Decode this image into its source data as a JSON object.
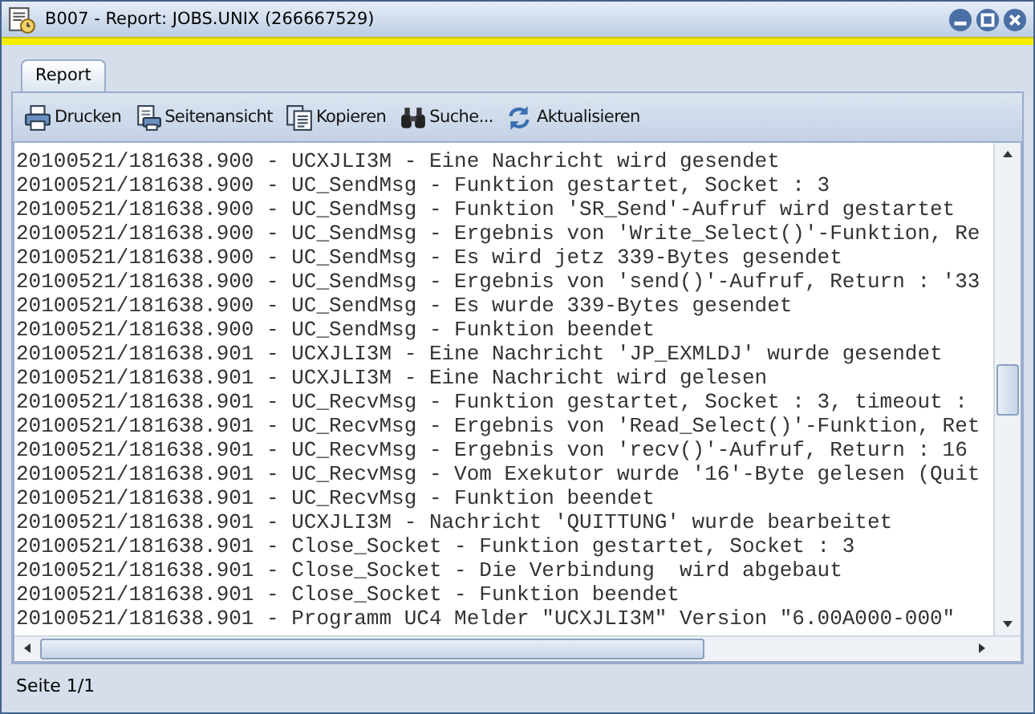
{
  "window": {
    "title": "B007 - Report: JOBS.UNIX (266667529)"
  },
  "tabs": [
    {
      "label": "Report",
      "selected": true
    }
  ],
  "toolbar": [
    {
      "kind": "print",
      "label": "Drucken"
    },
    {
      "kind": "preview",
      "label": "Seitenansicht"
    },
    {
      "kind": "copy",
      "label": "Kopieren"
    },
    {
      "kind": "search",
      "label": "Suche..."
    },
    {
      "kind": "refresh",
      "label": "Aktualisieren"
    }
  ],
  "log_lines": [
    "20100521/181638.900 - UCXJLI3M - Eine Nachricht wird gesendet",
    "20100521/181638.900 - UC_SendMsg - Funktion gestartet, Socket : 3",
    "20100521/181638.900 - UC_SendMsg - Funktion 'SR_Send'-Aufruf wird gestartet",
    "20100521/181638.900 - UC_SendMsg - Ergebnis von 'Write_Select()'-Funktion, Re",
    "20100521/181638.900 - UC_SendMsg - Es wird jetz 339-Bytes gesendet",
    "20100521/181638.900 - UC_SendMsg - Ergebnis von 'send()'-Aufruf, Return : '33",
    "20100521/181638.900 - UC_SendMsg - Es wurde 339-Bytes gesendet",
    "20100521/181638.900 - UC_SendMsg - Funktion beendet",
    "20100521/181638.901 - UCXJLI3M - Eine Nachricht 'JP_EXMLDJ' wurde gesendet",
    "20100521/181638.901 - UCXJLI3M - Eine Nachricht wird gelesen",
    "20100521/181638.901 - UC_RecvMsg - Funktion gestartet, Socket : 3, timeout :",
    "20100521/181638.901 - UC_RecvMsg - Ergebnis von 'Read_Select()'-Funktion, Ret",
    "20100521/181638.901 - UC_RecvMsg - Ergebnis von 'recv()'-Aufruf, Return : 16",
    "20100521/181638.901 - UC_RecvMsg - Vom Exekutor wurde '16'-Byte gelesen (Quit",
    "20100521/181638.901 - UC_RecvMsg - Funktion beendet",
    "20100521/181638.901 - UCXJLI3M - Nachricht 'QUITTUNG' wurde bearbeitet",
    "20100521/181638.901 - Close_Socket - Funktion gestartet, Socket : 3",
    "20100521/181638.901 - Close_Socket - Die Verbindung  wird abgebaut",
    "20100521/181638.901 - Close_Socket - Funktion beendet",
    "20100521/181638.901 - Programm UC4 Melder \"UCXJLI3M\" Version \"6.00A000-000\""
  ],
  "status_bar": {
    "text": "Seite 1/1"
  }
}
